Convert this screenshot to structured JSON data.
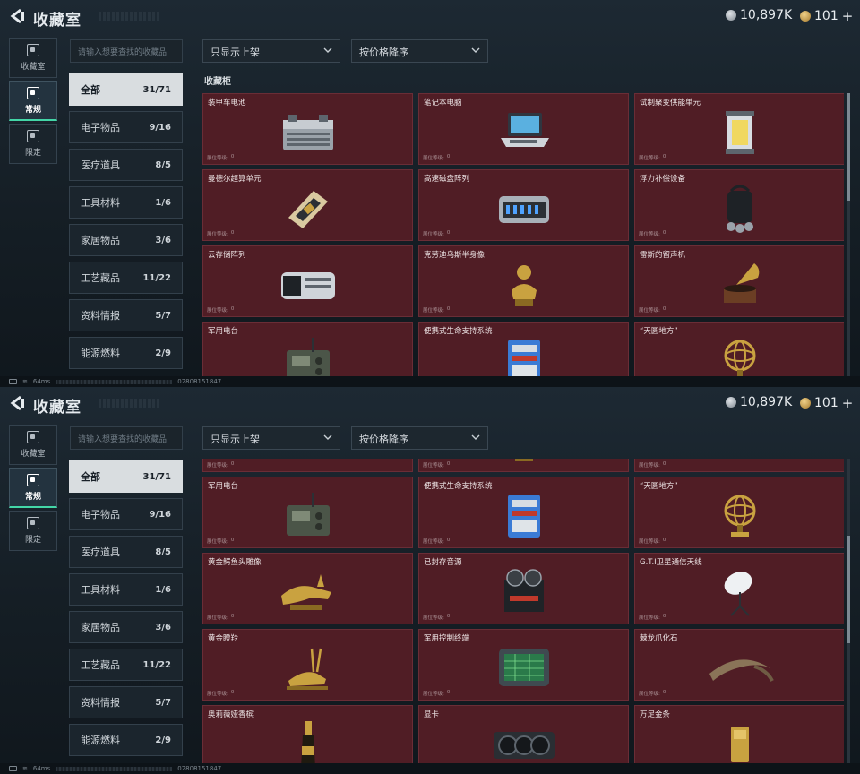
{
  "page_title": "收藏室",
  "currency": {
    "coins": "10,897K",
    "tickets": "101"
  },
  "left_tabs": [
    {
      "label": "收藏室"
    },
    {
      "label": "常规"
    },
    {
      "label": "限定"
    }
  ],
  "search": {
    "placeholder": "请输入想要查找的收藏品"
  },
  "filter_dropdown": {
    "value": "只显示上架"
  },
  "sort_dropdown": {
    "value": "按价格降序"
  },
  "categories": [
    {
      "label": "全部",
      "count": "31/71"
    },
    {
      "label": "电子物品",
      "count": "9/16"
    },
    {
      "label": "医疗道具",
      "count": "8/5"
    },
    {
      "label": "工具材料",
      "count": "1/6"
    },
    {
      "label": "家居物品",
      "count": "3/6"
    },
    {
      "label": "工艺藏品",
      "count": "11/22"
    },
    {
      "label": "资料情报",
      "count": "5/7"
    },
    {
      "label": "能源燃料",
      "count": "2/9"
    }
  ],
  "shelf_label": "收藏柜",
  "level_label": "展位等级:",
  "items": [
    {
      "name": "装甲车电池",
      "level": "0",
      "icon": "battery-icon"
    },
    {
      "name": "笔记本电脑",
      "level": "0",
      "icon": "laptop-icon"
    },
    {
      "name": "试制聚变供能单元",
      "level": "0",
      "icon": "fusion-cell-icon"
    },
    {
      "name": "曼德尔超算单元",
      "level": "0",
      "icon": "compute-unit-icon"
    },
    {
      "name": "高速磁盘阵列",
      "level": "0",
      "icon": "disk-array-icon"
    },
    {
      "name": "浮力补偿设备",
      "level": "0",
      "icon": "bcd-icon"
    },
    {
      "name": "云存储阵列",
      "level": "0",
      "icon": "cloud-storage-icon"
    },
    {
      "name": "克劳迪乌斯半身像",
      "level": "0",
      "icon": "bust-icon"
    },
    {
      "name": "雷斯的留声机",
      "level": "0",
      "icon": "phonograph-icon"
    },
    {
      "name": "军用电台",
      "level": "0",
      "icon": "radio-icon"
    },
    {
      "name": "便携式生命支持系统",
      "level": "0",
      "icon": "life-support-icon"
    },
    {
      "name": "“天圆地方”",
      "level": "0",
      "icon": "armillary-icon"
    },
    {
      "name": "黄金鳄鱼头雕像",
      "level": "0",
      "icon": "croc-statue-icon"
    },
    {
      "name": "已封存音源",
      "level": "0",
      "icon": "reel-recorder-icon"
    },
    {
      "name": "G.T.I卫星通信天线",
      "level": "0",
      "icon": "satellite-dish-icon"
    },
    {
      "name": "黄金瞪羚",
      "level": "0",
      "icon": "gazelle-icon"
    },
    {
      "name": "军用控制终端",
      "level": "0",
      "icon": "terminal-icon"
    },
    {
      "name": "棘龙爪化石",
      "level": "0",
      "icon": "claw-fossil-icon"
    },
    {
      "name": "奥莉薇娅香槟",
      "level": "0",
      "icon": "champagne-icon"
    },
    {
      "name": "显卡",
      "level": "0",
      "icon": "gpu-icon"
    },
    {
      "name": "万足金条",
      "level": "0",
      "icon": "gold-bar-icon"
    }
  ],
  "status": {
    "ping": "64ms",
    "uid": "02808151847"
  },
  "colors": {
    "card_bg": "#501d25",
    "accent": "#43d6a7",
    "active_cat_bg": "#d9dde0"
  }
}
